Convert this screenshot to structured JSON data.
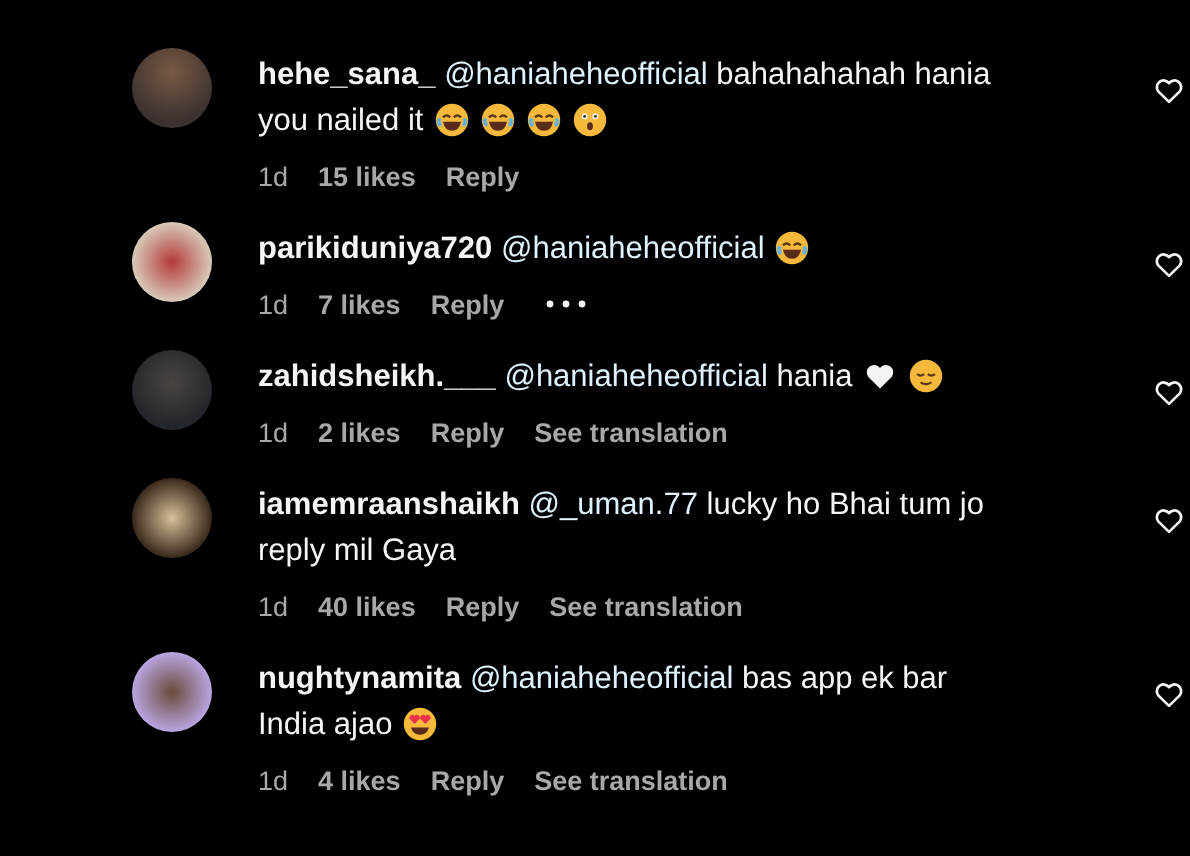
{
  "comments": [
    {
      "username": "hehe_sana_",
      "mention": "@haniaheheofficial",
      "text": "bahahahahah hania you nailed it",
      "emojis": [
        {
          "kind": "joy"
        },
        {
          "kind": "joy"
        },
        {
          "kind": "joy"
        },
        {
          "kind": "surprised"
        }
      ],
      "time": "1d",
      "likes": "15 likes",
      "reply": "Reply",
      "options_shown": false
    },
    {
      "username": "parikiduniya720",
      "mention": "@haniaheheofficial",
      "emojis": [
        {
          "kind": "joy"
        }
      ],
      "time": "1d",
      "likes": "7 likes",
      "reply": "Reply",
      "options_shown": true
    },
    {
      "username": "zahidsheikh.___",
      "mention": "@haniaheheofficial",
      "text": "hania",
      "emojis": [
        {
          "kind": "white-heart"
        },
        {
          "kind": "relieved"
        }
      ],
      "time": "1d",
      "likes": "2 likes",
      "reply": "Reply",
      "translate": "See translation",
      "options_shown": false
    },
    {
      "username": "iamemraanshaikh",
      "mention": "@_uman.77",
      "text": "lucky ho Bhai tum jo reply mil Gaya",
      "time": "1d",
      "likes": "40 likes",
      "reply": "Reply",
      "translate": "See translation",
      "options_shown": false
    },
    {
      "username": "nughtynamita",
      "mention": "@haniaheheofficial",
      "text": "bas app ek bar India ajao",
      "emojis": [
        {
          "kind": "heart-eyes"
        }
      ],
      "time": "1d",
      "likes": "4 likes",
      "reply": "Reply",
      "translate": "See translation",
      "options_shown": false
    }
  ]
}
